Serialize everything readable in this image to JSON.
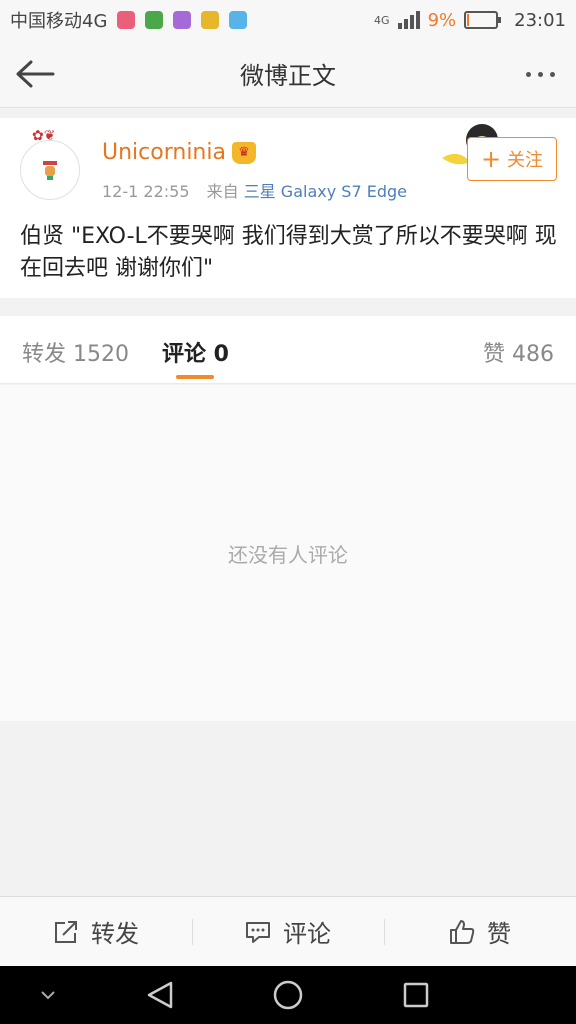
{
  "status_bar": {
    "carrier": "中国移动4G",
    "network_badge": "4G",
    "battery_percent": "9%",
    "time": "23:01",
    "app_icon_colors": [
      "#e8607a",
      "#4aa84a",
      "#a56ad6",
      "#e8b62a",
      "#56b4e9"
    ]
  },
  "nav": {
    "title": "微博正文",
    "back_icon": "back-arrow-icon",
    "more_icon": "more-dots-icon"
  },
  "post": {
    "username": "Unicorninia",
    "timestamp": "12-1 22:55",
    "from_label": "来自",
    "source": "三星 Galaxy S7 Edge",
    "follow_label": "关注",
    "text": "伯贤 \"EXO-L不要哭啊 我们得到大赏了所以不要哭啊 现在回去吧 谢谢你们\""
  },
  "tabs": {
    "repost": "转发 1520",
    "comment": "评论 0",
    "like": "赞 486"
  },
  "comments": {
    "empty_text": "还没有人评论"
  },
  "bottom_bar": {
    "repost": "转发",
    "comment": "评论",
    "like": "赞"
  },
  "colors": {
    "accent": "#f08a2c",
    "username": "#e8761d",
    "link": "#4e7fb8"
  }
}
